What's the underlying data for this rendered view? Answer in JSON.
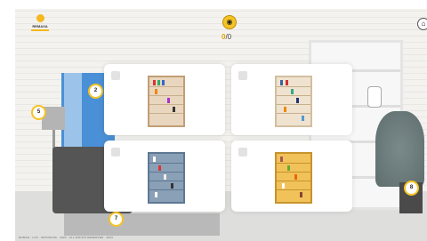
{
  "header": {
    "logo_text": "REMAXA",
    "counter_icon": "owl-icon",
    "counter_found": "0",
    "counter_total": "/0",
    "home_icon": "home-icon"
  },
  "pins": [
    "2",
    "5",
    "7",
    "8"
  ],
  "footer": "ROMAN · LUX · ANTONOVA · 2023 · ALL RIGHTS RESERVED · 2023",
  "options": [
    {
      "id": "bookcase-1",
      "style": "wood-colorful"
    },
    {
      "id": "bookcase-2",
      "style": "cream-blue"
    },
    {
      "id": "bookcase-3",
      "style": "grey-blue"
    },
    {
      "id": "bookcase-4",
      "style": "yellow-orange"
    }
  ],
  "colors": {
    "accent": "#f5c324",
    "curtain": "#4a90d6",
    "sofa": "#555555"
  }
}
